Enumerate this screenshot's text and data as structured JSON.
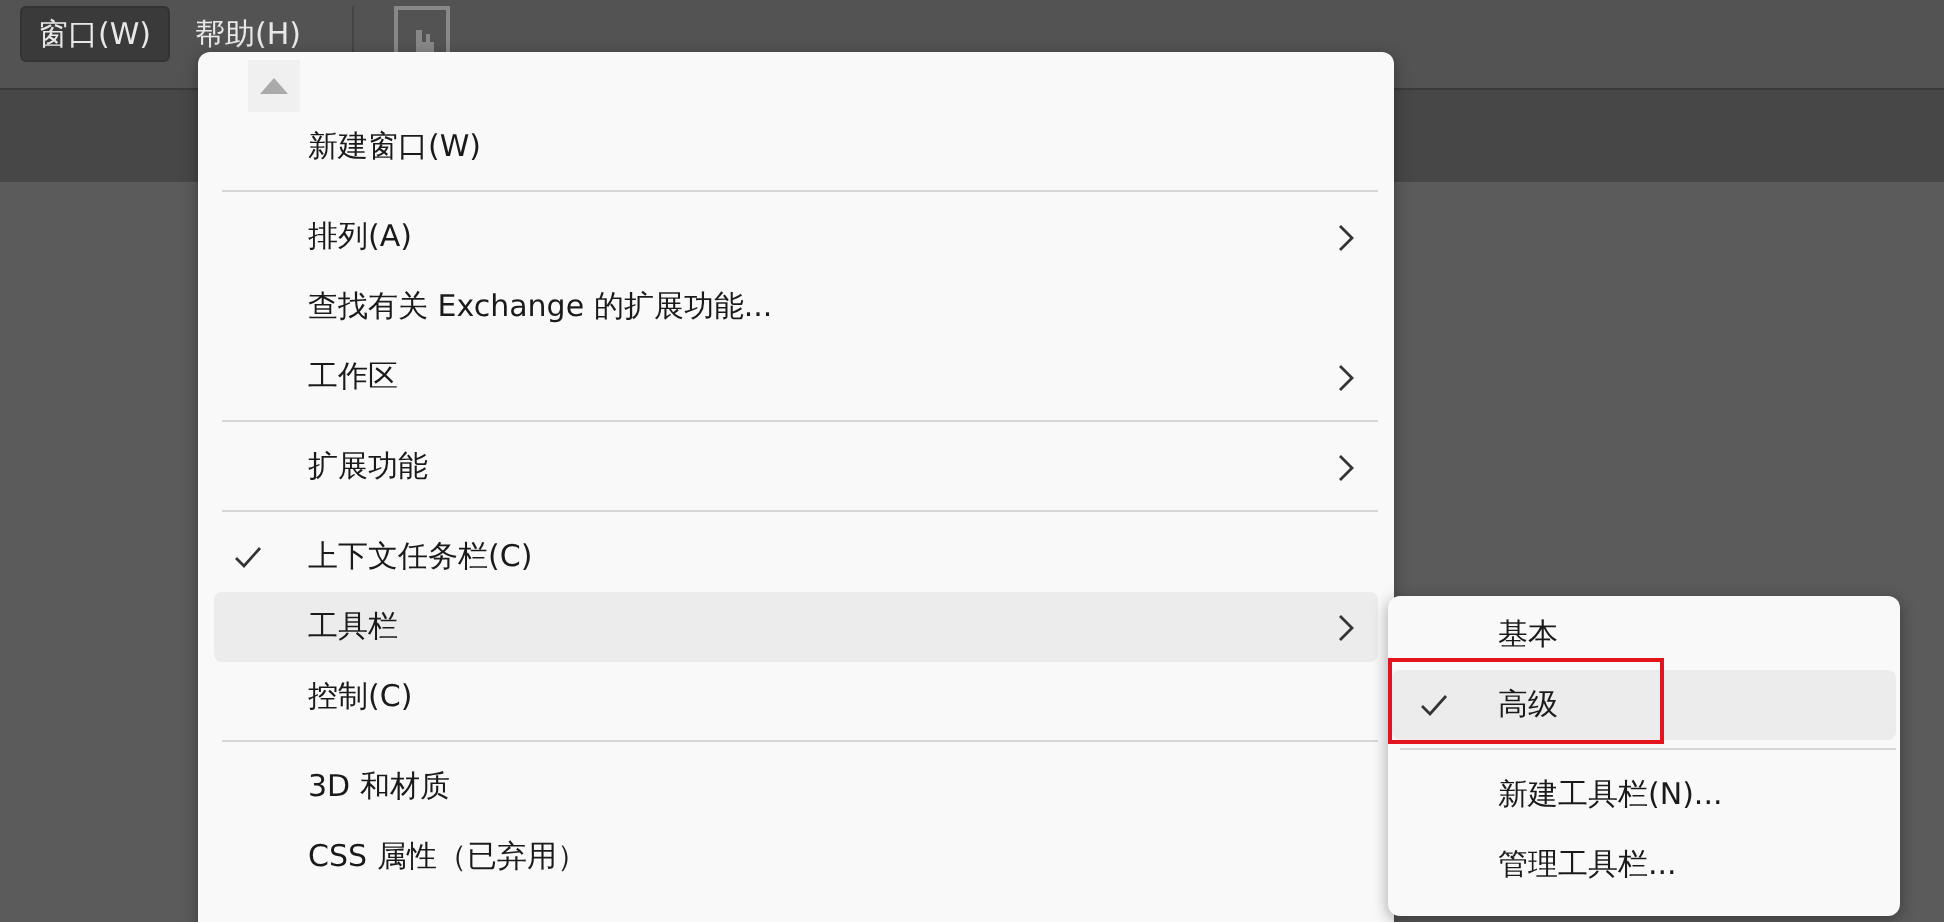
{
  "menubar": [
    {
      "label": "窗口(W)",
      "selected": true
    },
    {
      "label": "帮助(H)",
      "selected": false
    }
  ],
  "menu": {
    "items": [
      {
        "kind": "item",
        "label": "新建窗口(W)",
        "checked": false,
        "submenu": false,
        "selected": false
      },
      {
        "kind": "separator"
      },
      {
        "kind": "item",
        "label": "排列(A)",
        "checked": false,
        "submenu": true,
        "selected": false
      },
      {
        "kind": "item",
        "label": "查找有关 Exchange 的扩展功能...",
        "checked": false,
        "submenu": false,
        "selected": false
      },
      {
        "kind": "item",
        "label": "工作区",
        "checked": false,
        "submenu": true,
        "selected": false
      },
      {
        "kind": "separator"
      },
      {
        "kind": "item",
        "label": "扩展功能",
        "checked": false,
        "submenu": true,
        "selected": false
      },
      {
        "kind": "separator"
      },
      {
        "kind": "item",
        "label": "上下文任务栏(C)",
        "checked": true,
        "submenu": false,
        "selected": false
      },
      {
        "kind": "item",
        "label": "工具栏",
        "checked": false,
        "submenu": true,
        "selected": true
      },
      {
        "kind": "item",
        "label": "控制(C)",
        "checked": false,
        "submenu": false,
        "selected": false
      },
      {
        "kind": "separator"
      },
      {
        "kind": "item",
        "label": "3D 和材质",
        "checked": false,
        "submenu": false,
        "selected": false
      },
      {
        "kind": "item",
        "label": "CSS 属性（已弃用）",
        "checked": false,
        "submenu": false,
        "selected": false
      }
    ]
  },
  "submenu": {
    "items": [
      {
        "kind": "item",
        "label": "基本",
        "checked": false,
        "selected": false
      },
      {
        "kind": "item",
        "label": "高级",
        "checked": true,
        "selected": true
      },
      {
        "kind": "separator"
      },
      {
        "kind": "item",
        "label": "新建工具栏(N)...",
        "checked": false,
        "selected": false
      },
      {
        "kind": "item",
        "label": "管理工具栏...",
        "checked": false,
        "selected": false
      }
    ]
  }
}
